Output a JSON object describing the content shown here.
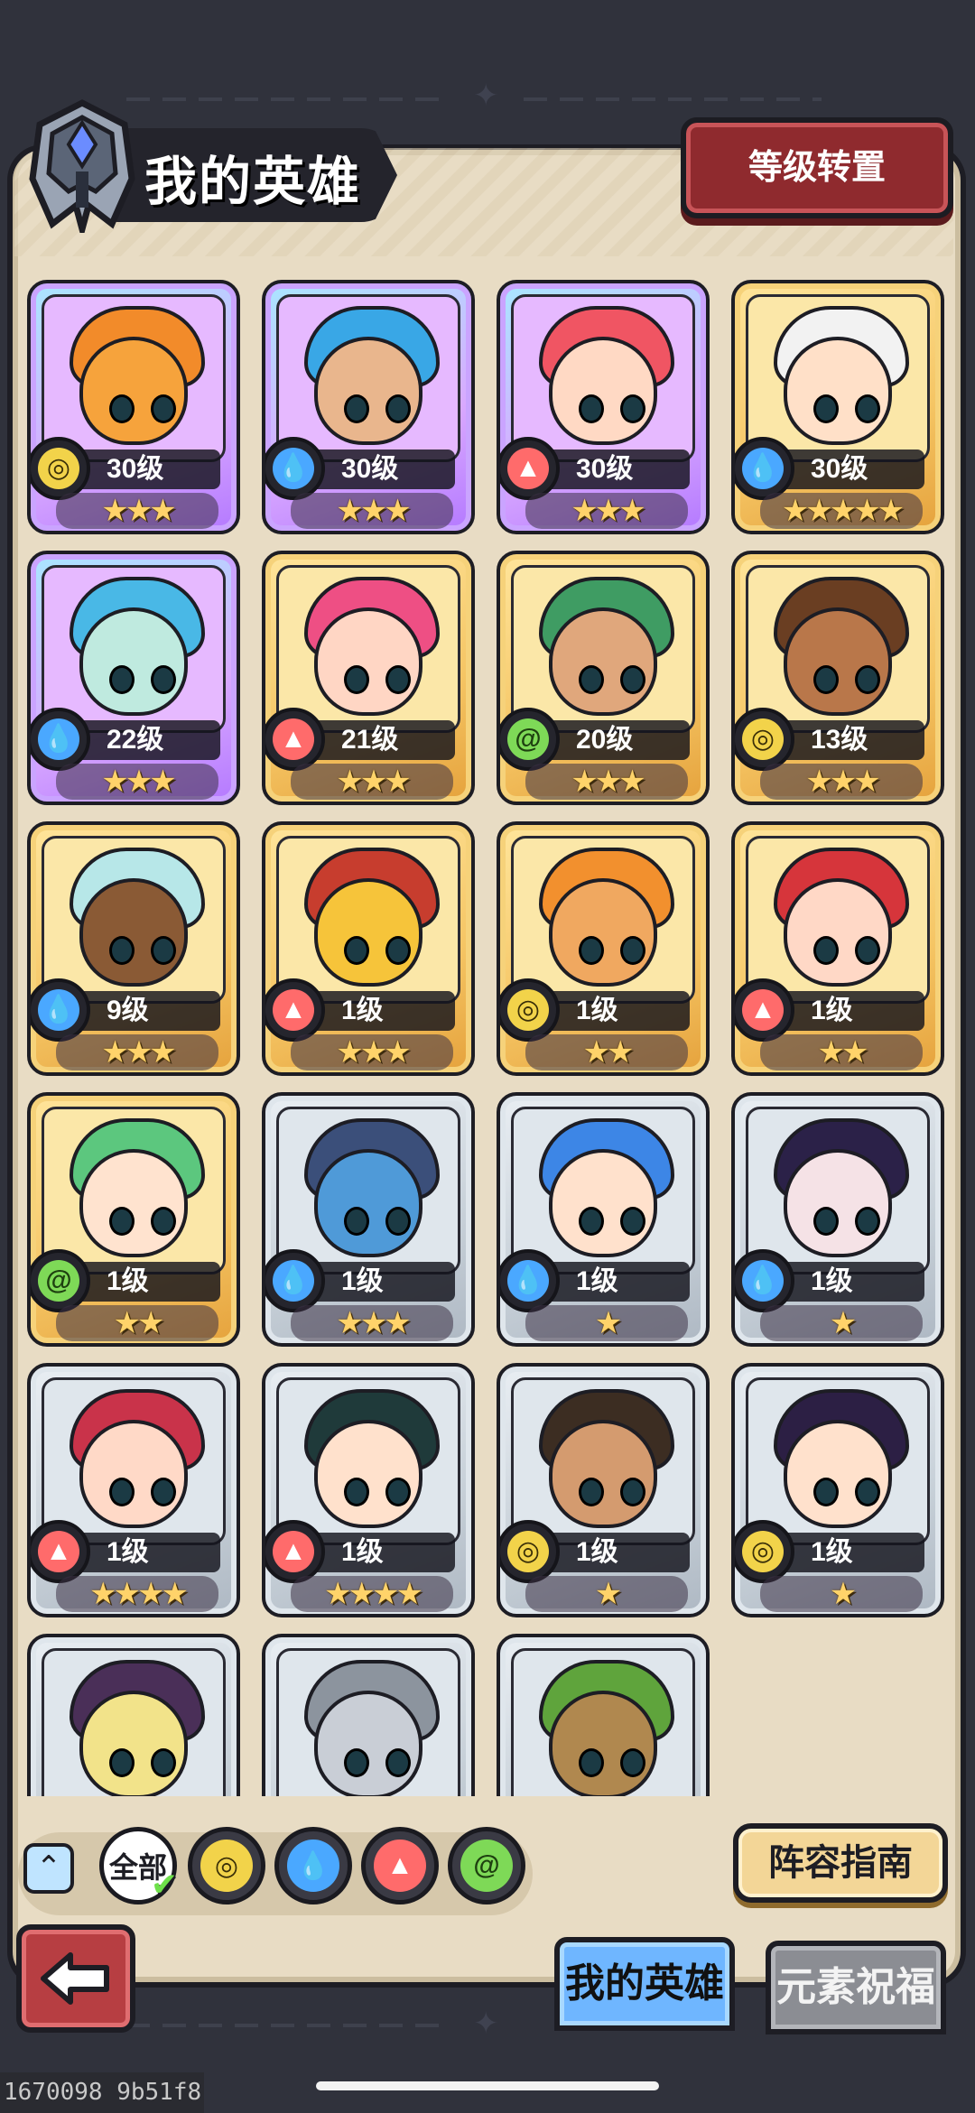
{
  "header": {
    "title": "我的英雄",
    "level_transfer_label": "等级转置"
  },
  "heroes": [
    {
      "level_label": "30级",
      "stars": 3,
      "element": "earth",
      "frame": "purple",
      "face_color": "#f6a33c",
      "hair_color": "#f28b2a"
    },
    {
      "level_label": "30级",
      "stars": 3,
      "element": "water",
      "frame": "purple",
      "face_color": "#e9b68d",
      "hair_color": "#39a7e6"
    },
    {
      "level_label": "30级",
      "stars": 3,
      "element": "fire",
      "frame": "purple",
      "face_color": "#ffd9c4",
      "hair_color": "#f05563"
    },
    {
      "level_label": "30级",
      "stars": 5,
      "element": "water",
      "frame": "gold",
      "face_color": "#ffe0c8",
      "hair_color": "#f2f2f2"
    },
    {
      "level_label": "22级",
      "stars": 3,
      "element": "water",
      "frame": "purple",
      "face_color": "#bfeadf",
      "hair_color": "#49b8e6"
    },
    {
      "level_label": "21级",
      "stars": 3,
      "element": "fire",
      "frame": "gold",
      "face_color": "#ffd6c4",
      "hair_color": "#ee4f84"
    },
    {
      "level_label": "20级",
      "stars": 3,
      "element": "wind",
      "frame": "gold",
      "face_color": "#e0a77c",
      "hair_color": "#3f9c63"
    },
    {
      "level_label": "13级",
      "stars": 3,
      "element": "earth",
      "frame": "gold",
      "face_color": "#b9774a",
      "hair_color": "#6a3e22"
    },
    {
      "level_label": "9级",
      "stars": 3,
      "element": "water",
      "frame": "gold",
      "face_color": "#8a5a35",
      "hair_color": "#b7e7e8"
    },
    {
      "level_label": "1级",
      "stars": 3,
      "element": "fire",
      "frame": "gold",
      "face_color": "#f6c43a",
      "hair_color": "#c73d2e"
    },
    {
      "level_label": "1级",
      "stars": 2,
      "element": "earth",
      "frame": "gold",
      "face_color": "#f0a860",
      "hair_color": "#f2902e"
    },
    {
      "level_label": "1级",
      "stars": 2,
      "element": "fire",
      "frame": "gold",
      "face_color": "#ffd8c6",
      "hair_color": "#d6353b"
    },
    {
      "level_label": "1级",
      "stars": 2,
      "element": "wind",
      "frame": "gold",
      "face_color": "#ffe3cf",
      "hair_color": "#5cc77e"
    },
    {
      "level_label": "1级",
      "stars": 3,
      "element": "water",
      "frame": "silver",
      "face_color": "#4f9ad8",
      "hair_color": "#3b4f7a"
    },
    {
      "level_label": "1级",
      "stars": 1,
      "element": "water",
      "frame": "silver",
      "face_color": "#ffe1cc",
      "hair_color": "#3d86e6"
    },
    {
      "level_label": "1级",
      "stars": 1,
      "element": "water",
      "frame": "silver",
      "face_color": "#f5e2e6",
      "hair_color": "#2b2148"
    },
    {
      "level_label": "1级",
      "stars": 4,
      "element": "fire",
      "frame": "silver",
      "face_color": "#ffd9c7",
      "hair_color": "#c9334a"
    },
    {
      "level_label": "1级",
      "stars": 4,
      "element": "fire",
      "frame": "silver",
      "face_color": "#ffe1cc",
      "hair_color": "#1f3a3a"
    },
    {
      "level_label": "1级",
      "stars": 1,
      "element": "earth",
      "frame": "silver",
      "face_color": "#d49b6f",
      "hair_color": "#3c2d22"
    },
    {
      "level_label": "1级",
      "stars": 1,
      "element": "earth",
      "frame": "silver",
      "face_color": "#ffe1cc",
      "hair_color": "#2c1f44"
    },
    {
      "level_label": "",
      "stars": 0,
      "element": "",
      "frame": "silver",
      "face_color": "#f2e38a",
      "hair_color": "#4a2f58"
    },
    {
      "level_label": "",
      "stars": 0,
      "element": "",
      "frame": "silver",
      "face_color": "#c9ced6",
      "hair_color": "#8c949e"
    },
    {
      "level_label": "",
      "stars": 0,
      "element": "",
      "frame": "silver",
      "face_color": "#b0884f",
      "hair_color": "#5fa43c"
    }
  ],
  "filters": {
    "all_label": "全部",
    "items": [
      "earth-icon",
      "water-icon",
      "fire-icon",
      "wind-icon"
    ]
  },
  "lineup_guide_label": "阵容指南",
  "tabs": {
    "my_heroes": "我的英雄",
    "element_blessing": "元素祝福"
  },
  "build_id": "1670098 9b51f8",
  "colors": {
    "earth": "#f2d34a",
    "water": "#4aa8ff",
    "fire": "#ff6b6b",
    "wind": "#7ed957",
    "portrait_bg": {
      "purple": "#e6b9ff",
      "gold": "#fbe7a8",
      "silver": "#dfe6ec"
    }
  }
}
